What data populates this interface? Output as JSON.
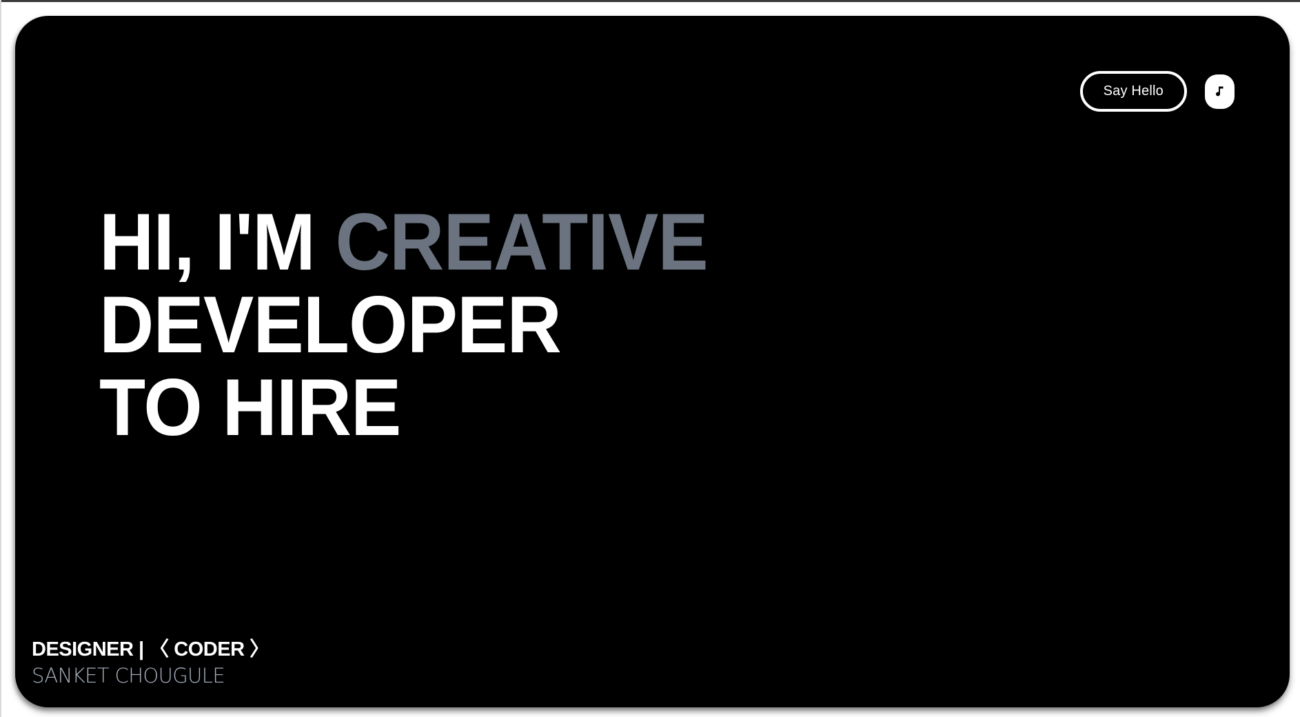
{
  "header": {
    "say_hello_label": "Say Hello",
    "music_icon": "music-note-icon"
  },
  "hero": {
    "line1_prefix": "HI, I'M ",
    "line1_accent": "CREATIVE",
    "line2": "DEVELOPER",
    "line3": "TO HIRE"
  },
  "footer": {
    "designer": "DESIGNER",
    "separator": " | ",
    "coder_open": "〈 ",
    "coder": "CODER",
    "coder_close": " 〉",
    "name": "SANKET CHOUGULE"
  },
  "colors": {
    "background": "#000000",
    "text": "#ffffff",
    "accent": "#6b7380",
    "name": "#a9b2bd"
  }
}
